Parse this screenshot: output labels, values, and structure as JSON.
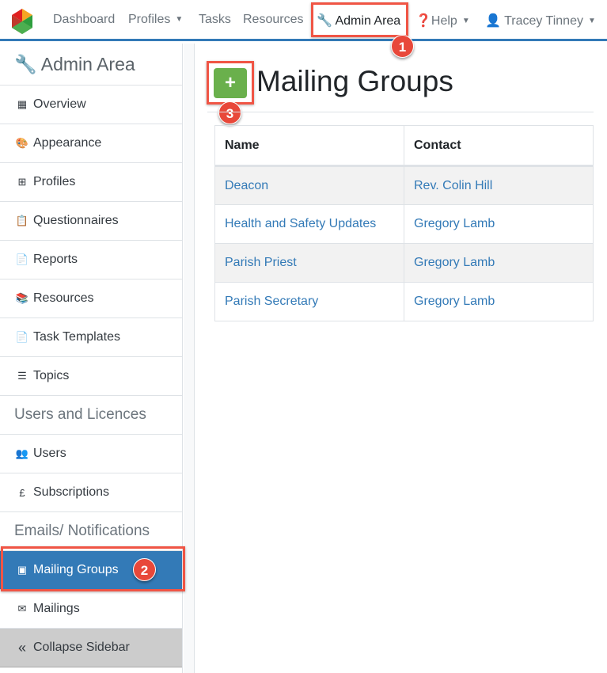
{
  "nav": {
    "items": [
      {
        "label": "Dashboard"
      },
      {
        "label": "Profiles",
        "dropdown": true
      },
      {
        "label": "Tasks"
      },
      {
        "label": "Resources"
      },
      {
        "label": "Admin Area",
        "icon": "wrench-icon",
        "active": true
      },
      {
        "label": "Help",
        "icon": "question-circle-icon",
        "dropdown": true
      },
      {
        "label": "Tracey Tinney",
        "icon": "user-icon",
        "dropdown": true
      }
    ]
  },
  "sidebar": {
    "title": "Admin Area",
    "items": [
      {
        "label": "Overview",
        "icon": "grid-icon"
      },
      {
        "label": "Appearance",
        "icon": "palette-icon"
      },
      {
        "label": "Profiles",
        "icon": "sitemap-icon"
      },
      {
        "label": "Questionnaires",
        "icon": "clipboard-check-icon"
      },
      {
        "label": "Reports",
        "icon": "file-export-icon"
      },
      {
        "label": "Resources",
        "icon": "books-icon"
      },
      {
        "label": "Task Templates",
        "icon": "file-icon"
      },
      {
        "label": "Topics",
        "icon": "list-icon"
      }
    ],
    "section_users": "Users and Licences",
    "users_items": [
      {
        "label": "Users",
        "icon": "users-cog-icon"
      },
      {
        "label": "Subscriptions",
        "icon": "pound-icon"
      }
    ],
    "section_emails": "Emails/ Notifications",
    "email_items": [
      {
        "label": "Mailing Groups",
        "icon": "address-book-icon",
        "active": true
      },
      {
        "label": "Mailings",
        "icon": "envelope-icon"
      }
    ],
    "collapse": "Collapse Sidebar"
  },
  "main": {
    "title": "Mailing Groups",
    "add_label": "+",
    "columns": [
      "Name",
      "Contact"
    ],
    "rows": [
      [
        "Deacon",
        "Rev. Colin Hill"
      ],
      [
        "Health and Safety Updates",
        "Gregory Lamb"
      ],
      [
        "Parish Priest",
        "Gregory Lamb"
      ],
      [
        "Parish Secretary",
        "Gregory Lamb"
      ]
    ]
  },
  "annotations": [
    "1",
    "2",
    "3"
  ],
  "colors": {
    "accent": "#337ab7",
    "add": "#6ab04c",
    "highlight": "#f05545"
  }
}
